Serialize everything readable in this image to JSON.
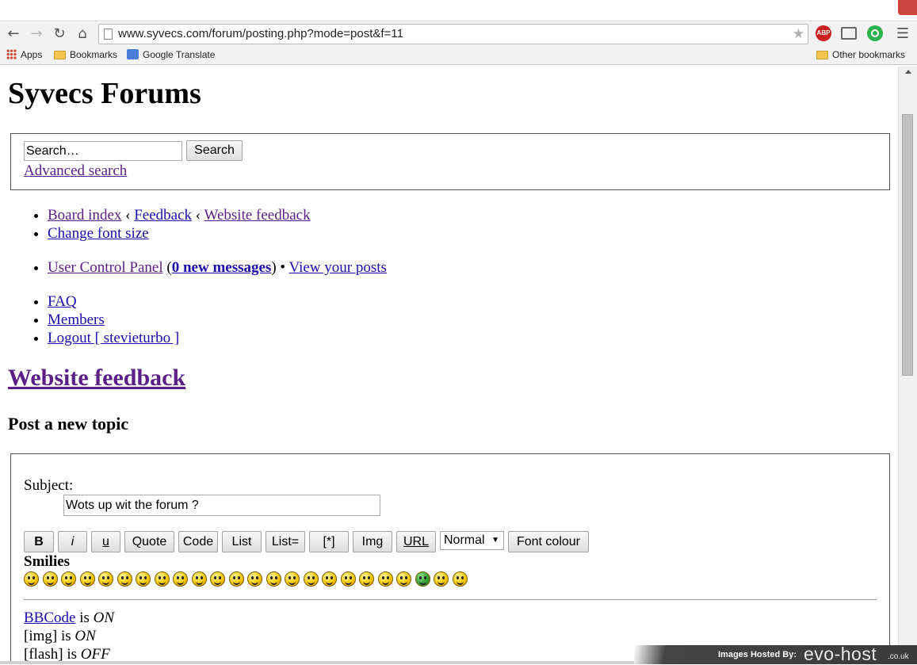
{
  "browser": {
    "url": "www.syvecs.com/forum/posting.php?mode=post&f=11",
    "bookmarks": [
      {
        "label": "Apps",
        "icon": "apps-grid-icon"
      },
      {
        "label": "Bookmarks",
        "icon": "folder-icon"
      },
      {
        "label": "Google Translate",
        "icon": "google-translate-icon"
      }
    ],
    "other_bookmarks": "Other bookmarks",
    "extensions": {
      "adblock": "ABP"
    }
  },
  "site": {
    "title": "Syvecs Forums",
    "search": {
      "placeholder": "Search…",
      "button": "Search",
      "advanced": "Advanced search"
    }
  },
  "nav": {
    "breadcrumb": [
      "Board index",
      "Feedback",
      "Website feedback"
    ],
    "breadcrumb_sep": "‹",
    "change_font": "Change font size",
    "ucp": "User Control Panel",
    "open_paren": "(",
    "new_messages": "0 new messages",
    "close_paren_sep": ") •",
    "view_posts": "View your posts",
    "faq": "FAQ",
    "members": "Members",
    "logout": "Logout [ stevieturbo ]"
  },
  "forum": {
    "heading": "Website feedback",
    "post_heading": "Post a new topic"
  },
  "form": {
    "subject_label": "Subject:",
    "subject_value": "Wots up wit the forum ?",
    "buttons": [
      "B",
      "i",
      "u",
      "Quote",
      "Code",
      "List",
      "List=",
      "[*]",
      "Img",
      "URL"
    ],
    "font_size_select": "Normal",
    "font_colour": "Font colour",
    "smilies_label": "Smilies",
    "smilies_count": 24,
    "status": [
      {
        "label": "BBCode",
        "suffix": "is",
        "value": "ON"
      },
      {
        "label": "[img]",
        "suffix": "is",
        "value": "ON"
      },
      {
        "label": "[flash]",
        "suffix": "is",
        "value": "OFF"
      }
    ]
  },
  "overlay": {
    "hosted_by": "Images Hosted By:",
    "brand": "evo-host",
    "tld": ".co.uk"
  }
}
